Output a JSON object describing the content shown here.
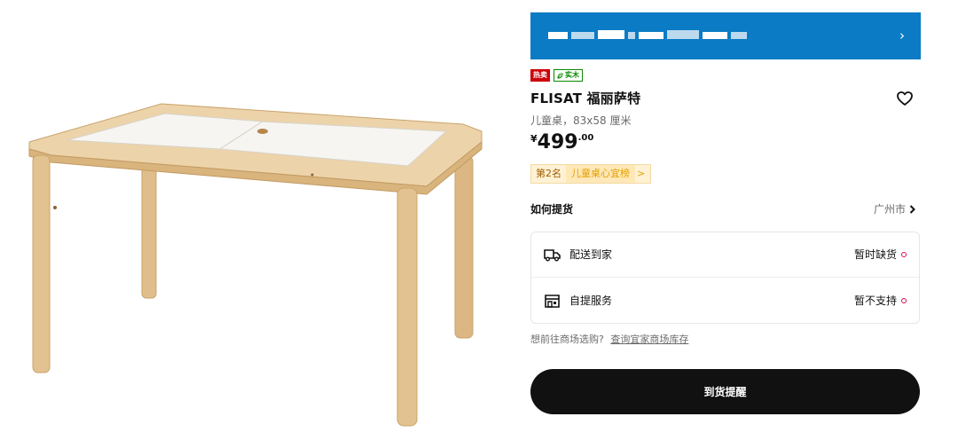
{
  "product": {
    "badges": {
      "hot": "热卖",
      "solid_wood": "实木"
    },
    "name": "FLISAT 福丽萨特",
    "description": "儿童桌，83x58 厘米",
    "price": {
      "currency": "¥",
      "integer": "499",
      "decimal": ".00"
    },
    "ranking": {
      "position": "第2名",
      "list": "儿童桌心宜榜",
      "arrow": ">"
    },
    "image_icon": "wooden-kids-table"
  },
  "banner": {
    "chevron": "›",
    "color": "#0a7bc4"
  },
  "pickup": {
    "title": "如何提货",
    "city": "广州市",
    "options": [
      {
        "label": "配送到家",
        "status": "暂时缺货",
        "icon": "truck-icon"
      },
      {
        "label": "自提服务",
        "status": "暂不支持",
        "icon": "store-icon"
      }
    ],
    "status_color": "#e00751"
  },
  "store_check": {
    "prompt": "想前往商场选购?",
    "link": "查询宜家商场库存"
  },
  "actions": {
    "notify": "到货提醒"
  }
}
